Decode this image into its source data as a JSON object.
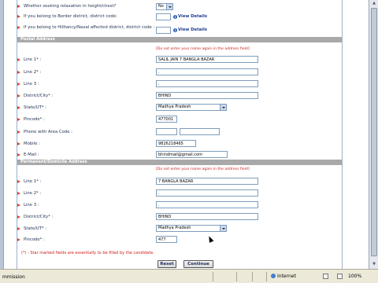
{
  "colors": {
    "section_bg": "#a9a9a9",
    "required_note": "#cc2222",
    "bullet": "#d9462b",
    "link": "#1f3f8f"
  },
  "top": {
    "relaxation_label": "Whether seeking relaxation in height/chest?",
    "relaxation_value": "No",
    "border_label": "If you belong to Border district, district code:",
    "border_value": "",
    "border_link": "View Details",
    "hilly_label": "If you belong to Hilltancy/Naxal affected district, district code :",
    "hilly_value": "",
    "hilly_link": "View Details"
  },
  "postal": {
    "title": "Postal Address",
    "note": "[Do not enter your name again in the address field]",
    "line1_label": "Line 1* :",
    "line1_value": "SALIL JAIN 7 BANGLA BAZAR",
    "line2_label": "Line 2* :",
    "line2_value": ".",
    "line3_label": "Line 3 :",
    "line3_value": ".",
    "district_label": "District/City* :",
    "district_value": "BHIND",
    "state_label": "State/UT* :",
    "state_value": "Madhya Pradesh",
    "pincode_label": "Pincode* :",
    "pincode_value": "477001",
    "phone_label": "Phone with Area Code :",
    "phone_code_value": "",
    "phone_number_value": "",
    "mobile_label": "Mobile :",
    "mobile_value": "9826218465",
    "email_label": "E-Mail :",
    "email_value": "bhindmail@gmail.com"
  },
  "permanent": {
    "title": "Permanent/Domicile Address",
    "note": "[Do not enter your name again in the address field]",
    "line1_label": "Line 1* :",
    "line1_value": "7 BANGLA BAZAR",
    "line2_label": "Line 2* :",
    "line2_value": ".",
    "line3_label": "Line 3 :",
    "line3_value": ".",
    "district_label": "District/City* :",
    "district_value": "BHIND",
    "state_label": "State/UT* :",
    "state_value": "Madhya Pradesh",
    "pincode_label": "Pincode* :",
    "pincode_value": "477"
  },
  "footer": {
    "note": "(*) - Star marked fields are essentially to be filled by the candidate.",
    "reset_label": "Reset",
    "continue_label": "Continue"
  },
  "statusbar": {
    "left_text": "mmission",
    "zone_label": "Internet",
    "zoom_label": "100%"
  }
}
